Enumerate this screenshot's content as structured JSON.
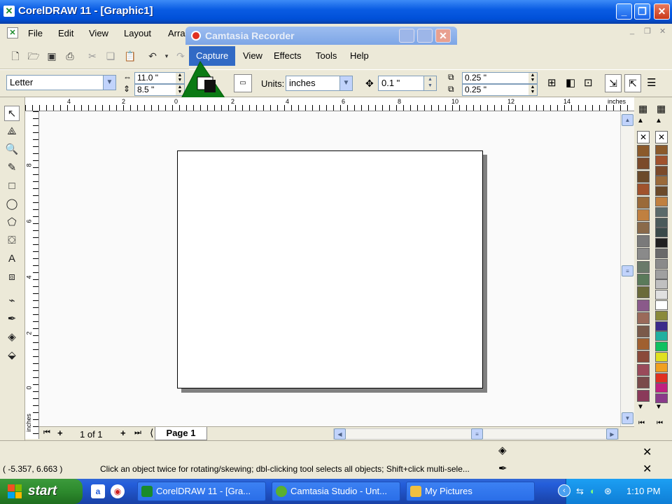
{
  "window": {
    "title": "CorelDRAW 11 - [Graphic1]",
    "app_icon": "coreldraw-icon"
  },
  "menu": {
    "file": "File",
    "edit": "Edit",
    "view": "View",
    "layout": "Layout",
    "arrange": "Arra"
  },
  "recorder": {
    "title": "Camtasia Recorder",
    "menu": {
      "capture": "Capture",
      "view": "View",
      "effects": "Effects",
      "tools": "Tools",
      "help": "Help"
    }
  },
  "property_bar": {
    "paper_size": "Letter",
    "width": "11.0 \"",
    "height": "8.5 \"",
    "units_label": "Units:",
    "units_value": "inches",
    "nudge": "0.1 \"",
    "dup_x": "0.25 \"",
    "dup_y": "0.25 \""
  },
  "ruler": {
    "unit": "inches",
    "h_ticks": [
      "4",
      "2",
      "0",
      "2",
      "4",
      "6",
      "8",
      "10",
      "12",
      "14"
    ],
    "v_ticks": [
      "8",
      "6",
      "4",
      "2",
      "0"
    ],
    "v_unit": "inches"
  },
  "page_nav": {
    "count": "1 of 1",
    "tab": "Page 1"
  },
  "status": {
    "coords": "( -5.357, 6.663 )",
    "hint": "Click an object twice for rotating/skewing; dbl-clicking tool selects all objects; Shift+click multi-sele..."
  },
  "taskbar": {
    "start": "start",
    "tasks": [
      "CorelDRAW 11 - [Gra...",
      "Camtasia Studio - Unt...",
      "My Pictures"
    ],
    "clock": "1:10 PM"
  },
  "palette_colors": [
    "#8b5a2b",
    "#a0522d",
    "#7b4a2a",
    "#9a6a3a",
    "#6b4a2a",
    "#c08040",
    "#5a6a6a",
    "#4a5a5a",
    "#3a4a4a",
    "#202020",
    "#6a6a6a",
    "#8a8a8a",
    "#a0a0a0",
    "#c0c0c0",
    "#e0e0e0",
    "#ffffff",
    "#8a8a3a",
    "#3a2a8a",
    "#20b0a0",
    "#10c060",
    "#e0e020",
    "#f0a020",
    "#e03020",
    "#c02080",
    "#8a3a8a"
  ],
  "colors": {
    "titlebar": "#0a5ce3",
    "taskbar": "#245edb",
    "start": "#2d8a2d"
  }
}
